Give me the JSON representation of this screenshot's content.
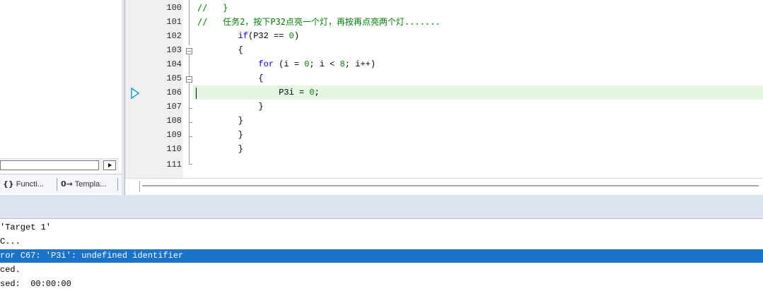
{
  "left_panel": {
    "tabs": [
      {
        "icon": "{}",
        "label": "Functi..."
      },
      {
        "icon": "0→",
        "label": "Templa..."
      }
    ]
  },
  "editor": {
    "lines": [
      {
        "n": "100",
        "text": "//   }"
      },
      {
        "n": "101",
        "text": "//   任务2，按下P32点亮一个灯，再按再点亮两个灯......."
      },
      {
        "n": "102",
        "text": "        if(P32 == 0)"
      },
      {
        "n": "103",
        "text": "        {"
      },
      {
        "n": "104",
        "text": "            for (i = 0; i < 8; i++)"
      },
      {
        "n": "105",
        "text": "            {"
      },
      {
        "n": "106",
        "text": "                P3i = 0;"
      },
      {
        "n": "107",
        "text": "            }"
      },
      {
        "n": "108",
        "text": "        }"
      },
      {
        "n": "109",
        "text": "        }"
      },
      {
        "n": "110",
        "text": "        }"
      },
      {
        "n": "111",
        "text": ""
      }
    ],
    "current_line": "106"
  },
  "build_output": {
    "lines": [
      "'Target 1'",
      "C...",
      "ror C67: 'P3i': undefined identifier",
      "ced.",
      "sed:  00:00:00"
    ],
    "selected_index": 2
  },
  "colors": {
    "highlight_line": "#e3f7e3",
    "selection": "#1a73c8",
    "keyword": "#0000ff",
    "comment": "#008000"
  }
}
